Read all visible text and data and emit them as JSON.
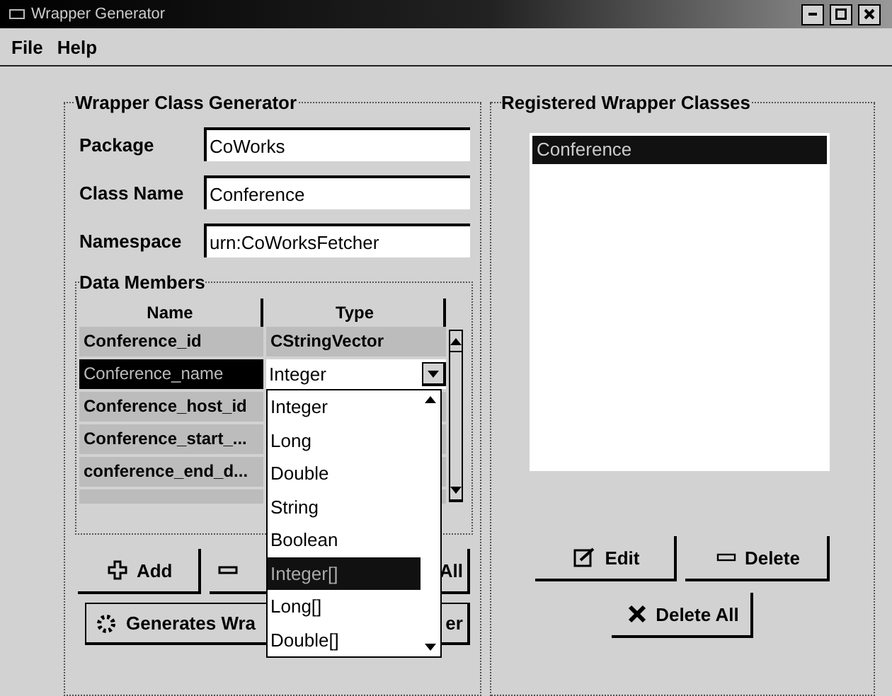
{
  "window": {
    "title": "Wrapper Generator"
  },
  "menu": [
    "File",
    "Help"
  ],
  "generator": {
    "title": "Wrapper Class Generator",
    "fields": [
      {
        "label": "Package",
        "value": "CoWorks"
      },
      {
        "label": "Class Name",
        "value": "Conference"
      },
      {
        "label": "Namespace",
        "value": "urn:CoWorksFetcher"
      }
    ],
    "data_members": {
      "title": "Data Members",
      "columns": [
        "Name",
        "Type"
      ],
      "rows": [
        {
          "name": "Conference_id",
          "type": "CStringVector",
          "selected": false
        },
        {
          "name": "Conference_name",
          "type": "Integer",
          "selected": true
        },
        {
          "name": "Conference_host_id",
          "type": "",
          "selected": false
        },
        {
          "name": "Conference_start_...",
          "type": "",
          "selected": false
        },
        {
          "name": "conference_end_d...",
          "type": "",
          "selected": false
        }
      ],
      "dropdown": [
        {
          "label": "Integer",
          "selected": false
        },
        {
          "label": "Long",
          "selected": false
        },
        {
          "label": "Double",
          "selected": false
        },
        {
          "label": "String",
          "selected": false
        },
        {
          "label": "Boolean",
          "selected": false
        },
        {
          "label": "Integer[]",
          "selected": true
        },
        {
          "label": "Long[]",
          "selected": false
        },
        {
          "label": "Double[]",
          "selected": false
        }
      ]
    },
    "add_button": "Add",
    "remove_all_visible": "All",
    "generate_visible": [
      "Generates Wra",
      "er"
    ]
  },
  "registered": {
    "title": "Registered Wrapper Classes",
    "items": [
      {
        "label": "Conference",
        "selected": true
      }
    ],
    "buttons": [
      "Edit",
      "Delete",
      "Delete All"
    ]
  }
}
